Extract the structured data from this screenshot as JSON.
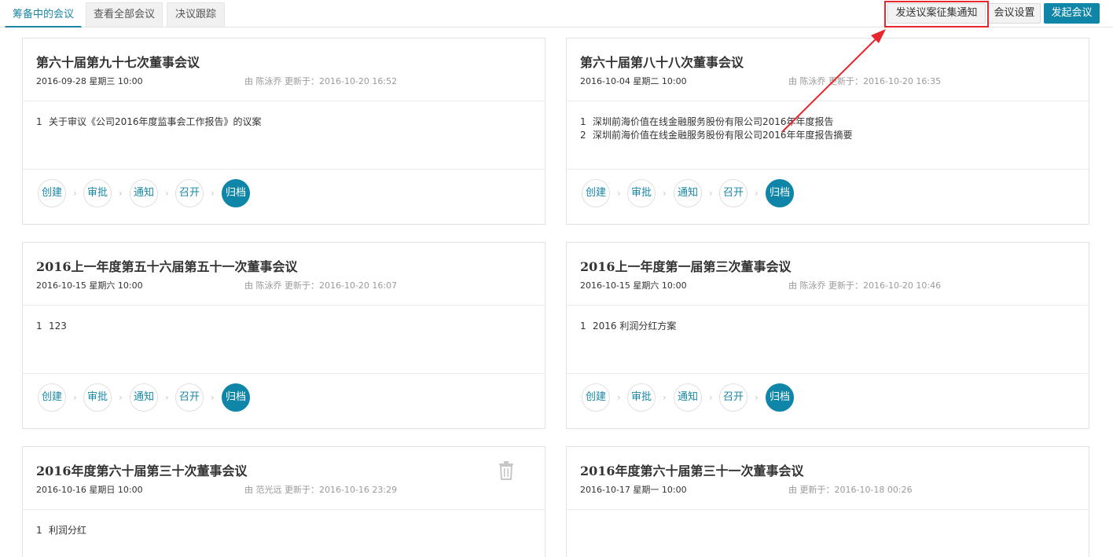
{
  "tabs": [
    {
      "label": "筹备中的会议",
      "active": true
    },
    {
      "label": "查看全部会议",
      "active": false
    },
    {
      "label": "决议跟踪",
      "active": false
    }
  ],
  "toolbar": {
    "notify_label": "发送议案征集通知",
    "settings_label": "会议设置",
    "start_label": "发起会议"
  },
  "steps": [
    "创建",
    "审批",
    "通知",
    "召开",
    "归档"
  ],
  "step_separator": "›",
  "cards": [
    {
      "title": "第六十届第九十七次董事会议",
      "date": "2016-09-28  星期三  10:00",
      "meta": "由  陈泳乔  更新于：2016-10-20 16:52",
      "items": [
        {
          "num": "1",
          "text": "关于审议《公司2016年度监事会工作报告》的议案"
        }
      ],
      "active_step": "归档"
    },
    {
      "title": "第六十届第八十八次董事会议",
      "date": "2016-10-04  星期二  10:00",
      "meta": "由  陈泳乔  更新于：2016-10-20 16:35",
      "items": [
        {
          "num": "1",
          "text": "深圳前海价值在线金融服务股份有限公司2016年年度报告"
        },
        {
          "num": "2",
          "text": "深圳前海价值在线金融服务股份有限公司2016年年度报告摘要"
        }
      ],
      "active_step": "归档"
    },
    {
      "title": "2016上一年度第五十六届第五十一次董事会议",
      "date": "2016-10-15  星期六  10:00",
      "meta": "由  陈泳乔  更新于：2016-10-20 16:07",
      "items": [
        {
          "num": "1",
          "text": "123"
        }
      ],
      "active_step": "归档"
    },
    {
      "title": "2016上一年度第一届第三次董事会议",
      "date": "2016-10-15  星期六  10:00",
      "meta": "由  陈泳乔  更新于：2016-10-20 10:46",
      "items": [
        {
          "num": "1",
          "text": "2016 利润分红方案"
        }
      ],
      "active_step": "归档"
    },
    {
      "title": "2016年度第六十届第三十次董事会议",
      "date": "2016-10-16  星期日  10:00",
      "meta": "由  范光远  更新于：2016-10-16 23:29",
      "items": [
        {
          "num": "1",
          "text": "利润分红"
        }
      ],
      "has_trash": true,
      "trash_icon": "trash-icon"
    },
    {
      "title": "2016年度第六十届第三十一次董事会议",
      "date": "2016-10-17  星期一  10:00",
      "meta": "由  更新于：2016-10-18 00:26",
      "items": []
    }
  ],
  "colors": {
    "accent": "#0f86a8",
    "highlight": "#e8262d"
  }
}
